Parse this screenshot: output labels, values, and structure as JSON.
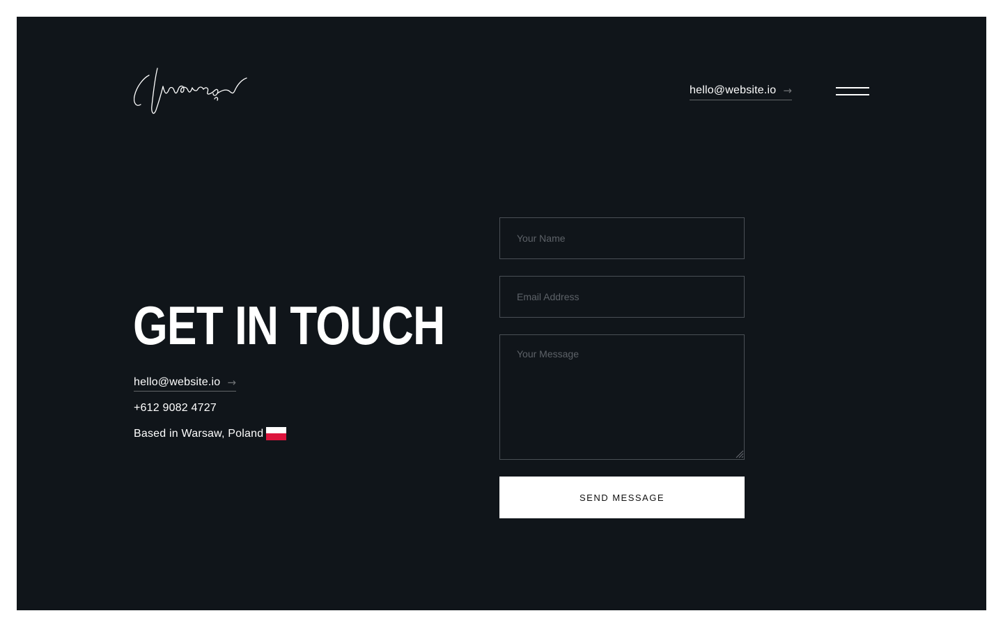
{
  "header": {
    "email_link": "hello@website.io",
    "arrow": "→",
    "menu_icon": "hamburger-icon",
    "logo": "signature-logo"
  },
  "hero": {
    "title": "GET IN TOUCH"
  },
  "contact": {
    "email": "hello@website.io",
    "arrow": "→",
    "phone": "+612 9082 4727",
    "location": "Based in Warsaw, Poland",
    "flag_icon": "poland-flag-icon"
  },
  "form": {
    "name_placeholder": "Your Name",
    "name_value": "",
    "email_placeholder": "Email Address",
    "email_value": "",
    "message_placeholder": "Your Message",
    "message_value": "",
    "submit_label": "SEND MESSAGE"
  },
  "colors": {
    "background": "#10151a",
    "page_border": "#ffffff",
    "text": "#ffffff",
    "field_border": "#4a5056",
    "placeholder": "#5d6268",
    "button_bg": "#ffffff",
    "button_text": "#111111",
    "flag_white": "#ffffff",
    "flag_red": "#dc143c"
  }
}
